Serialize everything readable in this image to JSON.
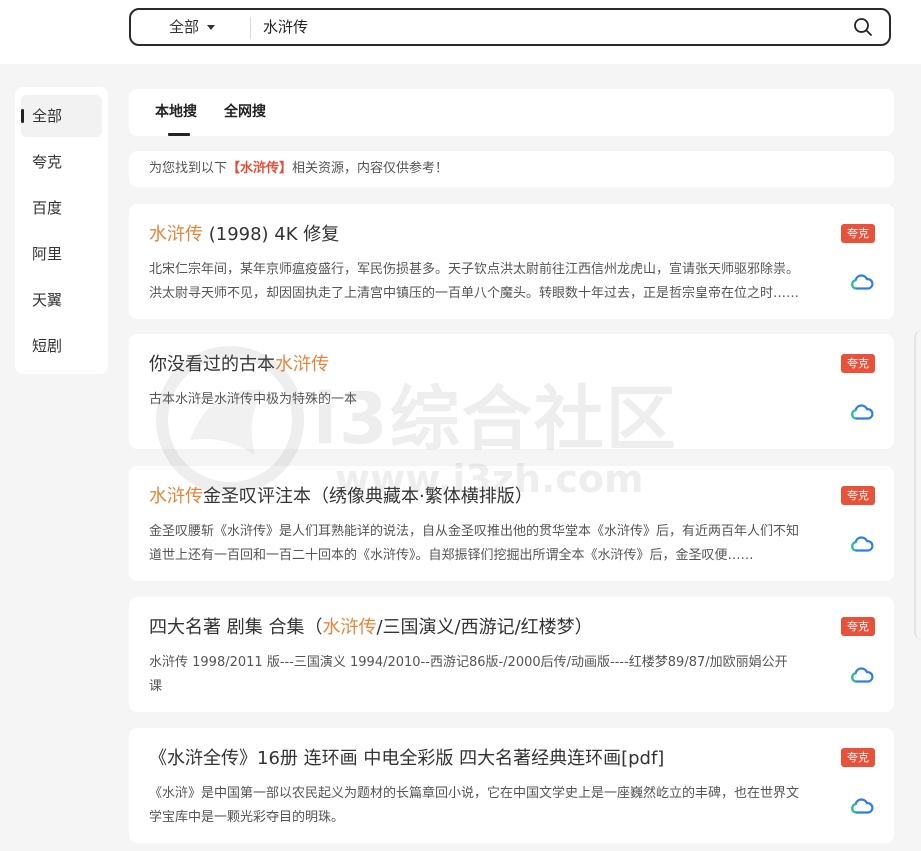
{
  "search": {
    "scope": "全部",
    "query": "水浒传"
  },
  "sidebar": {
    "items": [
      {
        "label": "全部",
        "active": true
      },
      {
        "label": "夸克"
      },
      {
        "label": "百度"
      },
      {
        "label": "阿里"
      },
      {
        "label": "天翼"
      },
      {
        "label": "短剧"
      }
    ]
  },
  "tabs": [
    {
      "label": "本地搜",
      "active": true
    },
    {
      "label": "全网搜"
    }
  ],
  "notice": {
    "prefix": "为您找到以下",
    "keyword": "【水浒传】",
    "suffix": "相关资源，内容仅供参考！"
  },
  "results": [
    {
      "title_pre": "",
      "title_hl": "水浒传",
      "title_post": " (1998) 4K 修复",
      "desc": "北宋仁宗年间，某年京师瘟疫盛行，军民伤损甚多。天子钦点洪太尉前往江西信州龙虎山，宣请张天师驱邪除祟。洪太尉寻天师不见，却因固执走了上清宫中镇压的一百单八个魔头。转眼数十年过去，正是哲宗皇帝在位之时……",
      "badge": "夸克"
    },
    {
      "title_pre": "你没看过的古本",
      "title_hl": "水浒传",
      "title_post": "",
      "desc": "古本水浒是水浒传中极为特殊的一本",
      "badge": "夸克"
    },
    {
      "title_pre": "",
      "title_hl": "水浒传",
      "title_post": "金圣叹评注本（绣像典藏本·繁体横排版）",
      "desc": "金圣叹腰斩《水浒传》是人们耳熟能详的说法，自从金圣叹推出他的贯华堂本《水浒传》后，有近两百年人们不知道世上还有一百回和一百二十回本的《水浒传》。自郑振铎们挖掘出所谓全本《水浒传》后，金圣叹便……",
      "badge": "夸克"
    },
    {
      "title_pre": "四大名著 剧集 合集（",
      "title_hl": "水浒传",
      "title_post": "/三国演义/西游记/红楼梦）",
      "desc": "水浒传 1998/2011 版---三国演义 1994/2010--西游记86版-/2000后传/动画版----红楼梦89/87/加欧丽娟公开课",
      "badge": "夸克"
    },
    {
      "title_pre": "《水浒全传》16册 连环画 中电全彩版 四大名著经典连环画[pdf]",
      "title_hl": "",
      "title_post": "",
      "desc": "《水浒》是中国第一部以农民起义为题材的长篇章回小说，它在中国文学史上是一座巍然屹立的丰碑，也在世界文学宝库中是一颗光彩夺目的明珠。",
      "badge": "夸克"
    }
  ],
  "watermark": {
    "name": "i3综合社区",
    "url": "www.i3zh.com"
  },
  "colors": {
    "accent": "#e8843a",
    "badge": "#e8513a",
    "keyword": "#e54d36"
  }
}
